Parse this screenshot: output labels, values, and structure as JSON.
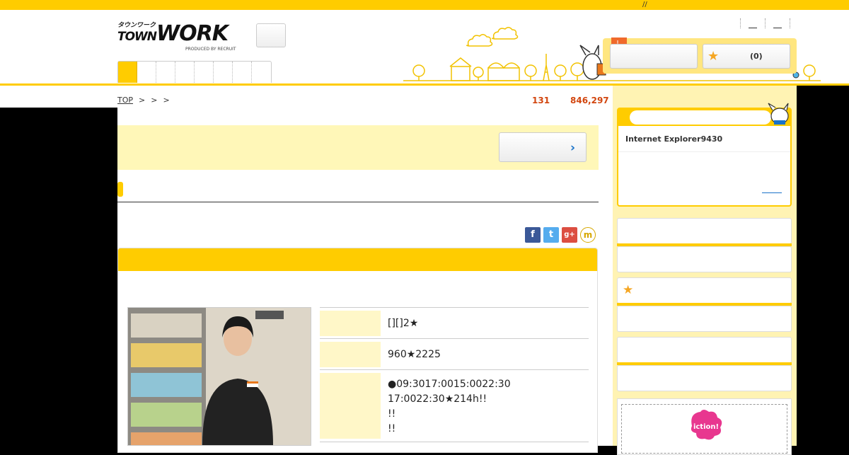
{
  "topbar": {
    "slashes": "//"
  },
  "header": {
    "logo": {
      "kana": "タウンワーク",
      "town": "TOWN",
      "work": "WORK",
      "sub": "PRODUCED BY RECRUIT"
    },
    "favorites": {
      "count": "(0)"
    },
    "alert_badge": "!"
  },
  "breadcrumb": {
    "top": "TOP",
    "separators": [
      ">",
      ">",
      ">"
    ]
  },
  "stats": {
    "count_1": "131",
    "count_2": "846,297"
  },
  "share": {
    "facebook": "f",
    "twitter": "t",
    "google": "g+",
    "mixi": "m"
  },
  "job": {
    "rows": [
      {
        "value_lines": [
          "[][]2★"
        ]
      },
      {
        "value_lines": [
          "960★2225"
        ]
      },
      {
        "value_lines": [
          "●09:3017:0015:0022:30",
          "17:0022:30★214h!!",
          "!!",
          "!!"
        ]
      }
    ]
  },
  "sidebar": {
    "notice": {
      "title": "Internet Explorer9430"
    },
    "ad": {
      "logo_text": "iction!"
    }
  },
  "colors": {
    "brand_yellow": "#ffcc00",
    "light_yellow": "#fff7b8",
    "accent_orange": "#d2460f",
    "link_blue": "#1a73c9"
  }
}
